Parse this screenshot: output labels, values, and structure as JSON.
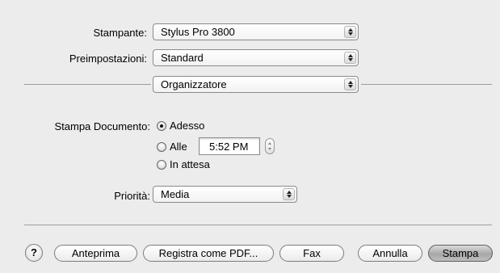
{
  "printer": {
    "label": "Stampante:",
    "value": "Stylus Pro 3800"
  },
  "presets": {
    "label": "Preimpostazioni:",
    "value": "Standard"
  },
  "panel": {
    "value": "Organizzatore"
  },
  "schedule": {
    "label": "Stampa Documento:",
    "options": [
      {
        "label": "Adesso",
        "selected": true
      },
      {
        "label": "Alle",
        "selected": false
      },
      {
        "label": "In attesa",
        "selected": false
      }
    ],
    "time": "5:52 PM"
  },
  "priority": {
    "label": "Priorità:",
    "value": "Media"
  },
  "buttons": {
    "help": "?",
    "preview": "Anteprima",
    "save_pdf": "Registra come PDF...",
    "fax": "Fax",
    "cancel": "Annulla",
    "print": "Stampa"
  },
  "icons": {
    "popup_arrows": "up-down-arrows-icon",
    "stepper": "stepper-arrows-icon",
    "help": "question-mark-icon"
  }
}
